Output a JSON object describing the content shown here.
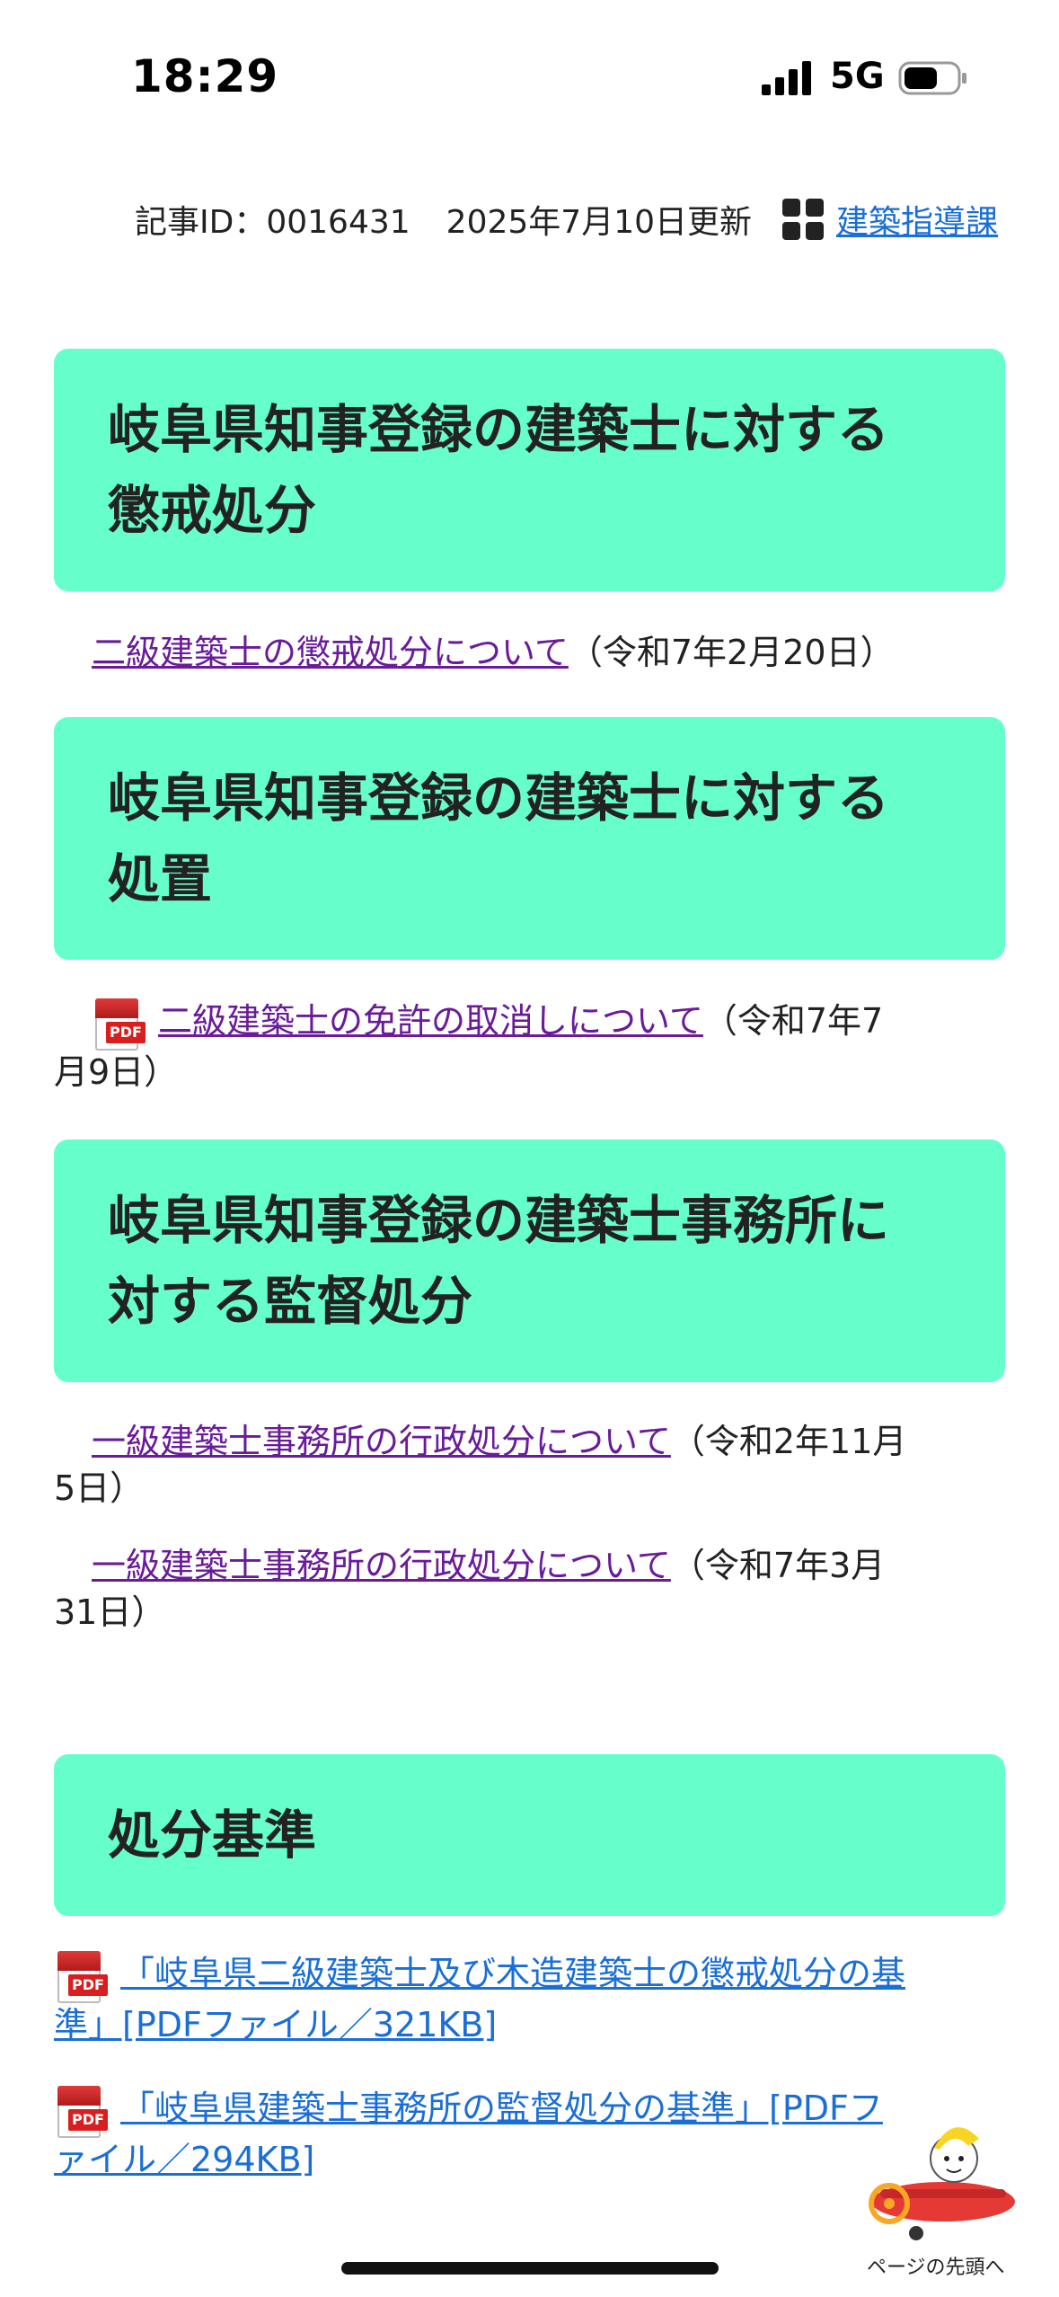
{
  "status": {
    "time": "18:29",
    "network": "5G"
  },
  "meta": {
    "article": "記事ID：0016431",
    "updated": "2025年7月10日更新",
    "department": "建築指導課"
  },
  "sections": [
    {
      "title_line1": "岐阜県知事登録の建築士に対する",
      "title_line2": "懲戒処分"
    },
    {
      "title_line1": "岐阜県知事登録の建築士に対する",
      "title_line2": "処置"
    },
    {
      "title_line1": "岐阜県知事登録の建築士事務所に",
      "title_line2": "対する監督処分"
    },
    {
      "title_line1": "処分基準"
    }
  ],
  "entries": {
    "e1": {
      "link": "二級建築士の懲戒処分について",
      "date": "（令和7年2月20日）"
    },
    "e2": {
      "link": "二級建築士の免許の取消しについて",
      "date_line1": "（令和7年7",
      "date_line2": "月9日）",
      "icon": "pdf-icon"
    },
    "e3": {
      "link": "一級建築士事務所の行政処分について",
      "date_line1": "（令和2年11月",
      "date_line2": "5日）"
    },
    "e4": {
      "link": "一級建築士事務所の行政処分について",
      "date_line1": "（令和7年3月",
      "date_line2": "31日）"
    },
    "e5": {
      "link_line1": "「岐阜県二級建築士及び木造建築士の懲戒処分の基",
      "link_line2": "準」[PDFファイル／321KB]",
      "icon": "pdf-icon"
    },
    "e6": {
      "link_line1": "「岐阜県建築士事務所の監督処分の基準」[PDFフ",
      "link_line2": "ァイル／294KB]",
      "icon": "pdf-icon"
    }
  },
  "pdf_label": "PDF",
  "back_to_top": "ページの先頭へ",
  "colors": {
    "section_bg": "#66ffcc",
    "visited_link": "#6a1b9a",
    "link": "#1a6ed8"
  }
}
